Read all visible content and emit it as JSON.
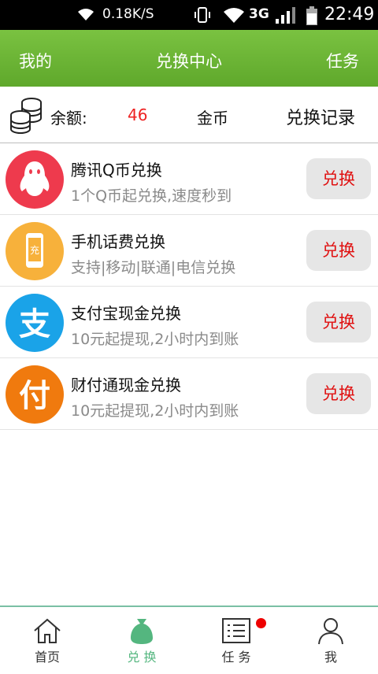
{
  "statusbar": {
    "speed": "0.18K/S",
    "network": "3G",
    "time": "22:49"
  },
  "header": {
    "left": "我的",
    "title": "兑换中心",
    "right": "任务"
  },
  "balance": {
    "label": "余额:",
    "value": "46",
    "unit": "金币",
    "record": "兑换记录"
  },
  "items": [
    {
      "title": "腾讯Q币兑换",
      "subtitle": "1个Q币起兑换,速度秒到",
      "button": "兑换",
      "icon": "qq-penguin-icon",
      "color": "#ee3a4d"
    },
    {
      "title": "手机话费兑换",
      "subtitle": "支持|移动|联通|电信兑换",
      "button": "兑换",
      "icon": "phone-charge-icon",
      "color": "#f7b13b",
      "icon_text": "充"
    },
    {
      "title": "支付宝现金兑换",
      "subtitle": "10元起提现,2小时内到账",
      "button": "兑换",
      "icon": "alipay-icon",
      "color": "#1aa3e8",
      "icon_text": "支"
    },
    {
      "title": "财付通现金兑换",
      "subtitle": "10元起提现,2小时内到账",
      "button": "兑换",
      "icon": "tenpay-icon",
      "color": "#f07a0e",
      "icon_text": "付"
    }
  ],
  "nav": [
    {
      "label": "首页",
      "icon": "home-icon"
    },
    {
      "label": "兑 换",
      "icon": "money-bag-icon",
      "active": true
    },
    {
      "label": "任 务",
      "icon": "task-list-icon",
      "badge": true
    },
    {
      "label": "我",
      "icon": "person-icon"
    }
  ],
  "colors": {
    "header": "#6db535",
    "price": "#e22222",
    "button_text": "#e01010",
    "active_tab": "#54b67f"
  }
}
